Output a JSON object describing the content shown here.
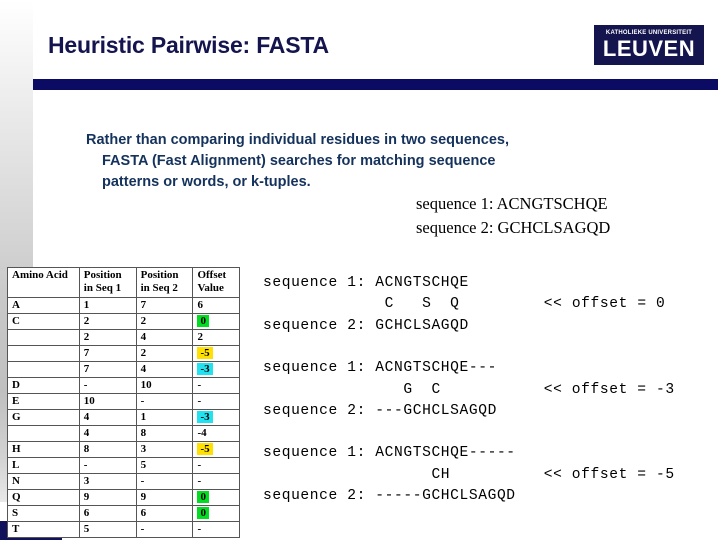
{
  "slide": {
    "title": "Heuristic Pairwise: FASTA",
    "logo": {
      "top_line": "KATHOLIEKE UNIVERSITEIT",
      "main": "LEUVEN"
    },
    "colors": {
      "title_text": "#14144E",
      "rule": "#0B0B63",
      "body_text": "#14325C",
      "highlight_green": "#00DD22",
      "highlight_yellow": "#FFE000",
      "highlight_cyan": "#21E2EE"
    }
  },
  "body": {
    "line1": "Rather than comparing individual residues in two sequences,",
    "line2": "FASTA (Fast Alignment) searches for matching sequence",
    "line3": "patterns or words, or k-tuples."
  },
  "sequences_serif": {
    "seq1": "sequence 1: ACNGTSCHQE",
    "seq2": "sequence 2: GCHCLSAGQD"
  },
  "table": {
    "headers": [
      "Amino Acid",
      "Position in Seq 1",
      "Position in Seq 2",
      "Offset Value"
    ],
    "headers_split": [
      {
        "l1": "Amino Acid",
        "l2": ""
      },
      {
        "l1": "Position",
        "l2": "in Seq 1"
      },
      {
        "l1": "Position",
        "l2": "in Seq 2"
      },
      {
        "l1": "Offset",
        "l2": "Value"
      }
    ],
    "rows": [
      {
        "aa": "A",
        "p1": "1",
        "p2": "7",
        "offset": "6",
        "hl": "none"
      },
      {
        "aa": "C",
        "p1": "2",
        "p2": "2",
        "offset": "0",
        "hl": "green"
      },
      {
        "aa": "",
        "p1": "2",
        "p2": "4",
        "offset": "2",
        "hl": "none"
      },
      {
        "aa": "",
        "p1": "7",
        "p2": "2",
        "offset": "-5",
        "hl": "yellow"
      },
      {
        "aa": "",
        "p1": "7",
        "p2": "4",
        "offset": "-3",
        "hl": "cyan"
      },
      {
        "aa": "D",
        "p1": "-",
        "p2": "10",
        "offset": "-",
        "hl": "none"
      },
      {
        "aa": "E",
        "p1": "10",
        "p2": "-",
        "offset": "-",
        "hl": "none"
      },
      {
        "aa": "G",
        "p1": "4",
        "p2": "1",
        "offset": "-3",
        "hl": "cyan"
      },
      {
        "aa": "",
        "p1": "4",
        "p2": "8",
        "offset": "-4",
        "hl": "none"
      },
      {
        "aa": "H",
        "p1": "8",
        "p2": "3",
        "offset": "-5",
        "hl": "yellow"
      },
      {
        "aa": "L",
        "p1": "-",
        "p2": "5",
        "offset": "-",
        "hl": "none"
      },
      {
        "aa": "N",
        "p1": "3",
        "p2": "-",
        "offset": "-",
        "hl": "none"
      },
      {
        "aa": "Q",
        "p1": "9",
        "p2": "9",
        "offset": "0",
        "hl": "green"
      },
      {
        "aa": "S",
        "p1": "6",
        "p2": "6",
        "offset": "0",
        "hl": "green"
      },
      {
        "aa": "T",
        "p1": "5",
        "p2": "-",
        "offset": "-",
        "hl": "none"
      }
    ]
  },
  "alignments": [
    {
      "top": "sequence 1: ACNGTSCHQE",
      "middle": "             C   S  Q",
      "bottom": "sequence 2: GCHCLSAGQD",
      "offset_label": "<< offset = 0"
    },
    {
      "top": "sequence 1: ACNGTSCHQE---",
      "middle": "               G  C",
      "bottom": "sequence 2: ---GCHCLSAGQD",
      "offset_label": "<< offset = -3"
    },
    {
      "top": "sequence 1: ACNGTSCHQE-----",
      "middle": "                  CH",
      "bottom": "sequence 2: -----GCHCLSAGQD",
      "offset_label": "<< offset = -5"
    }
  ]
}
